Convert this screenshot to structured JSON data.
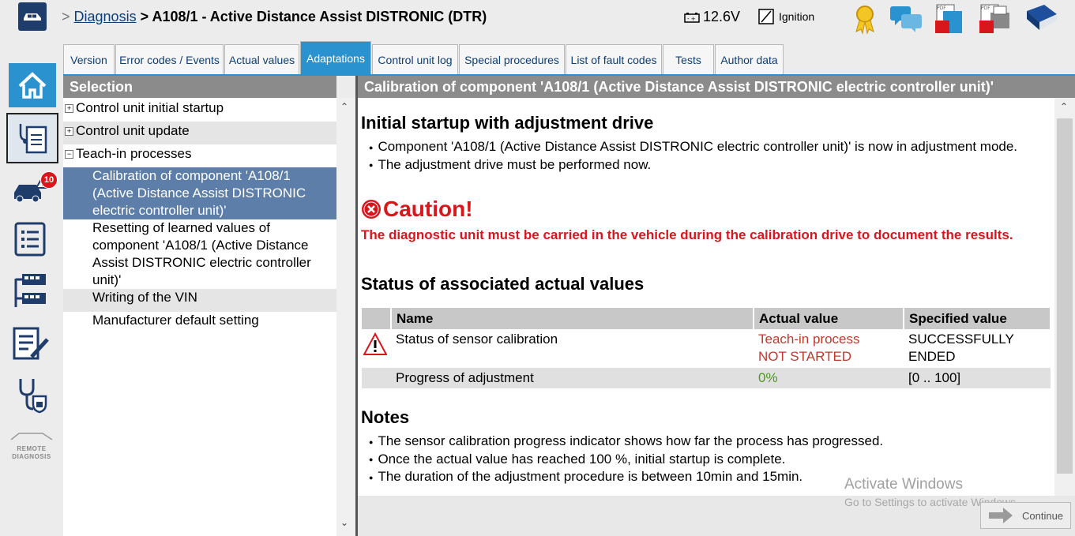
{
  "header": {
    "breadcrumb_sep": ">",
    "breadcrumb_link": "Diagnosis",
    "breadcrumb_current": "> A108/1 - Active Distance Assist DISTRONIC (DTR)",
    "voltage": "12.6V",
    "ignition_label": "Ignition"
  },
  "rail": {
    "badge_count": "10",
    "remote_line1": "REMOTE",
    "remote_line2": "DIAGNOSIS"
  },
  "tabs": [
    {
      "label": "Version"
    },
    {
      "label": "Error codes / Events"
    },
    {
      "label": "Actual values"
    },
    {
      "label": "Adaptations"
    },
    {
      "label": "Control unit log"
    },
    {
      "label": "Special procedures"
    },
    {
      "label": "List of fault codes"
    },
    {
      "label": "Tests"
    },
    {
      "label": "Author data"
    }
  ],
  "left_panel": {
    "header": "Selection",
    "items": [
      {
        "label": "Control unit initial startup",
        "toggle": "+"
      },
      {
        "label": "Control unit update",
        "toggle": "+"
      },
      {
        "label": "Teach-in processes",
        "toggle": "−"
      },
      {
        "label": "Calibration of component 'A108/1 (Active Distance Assist DISTRONIC electric controller unit)'"
      },
      {
        "label": "Resetting of learned values of component 'A108/1 (Active Distance Assist DISTRONIC electric controller unit)'"
      },
      {
        "label": "Writing of the VIN"
      },
      {
        "label": "Manufacturer default setting"
      }
    ]
  },
  "right_panel": {
    "header": "Calibration of component 'A108/1 (Active Distance Assist DISTRONIC electric controller unit)'",
    "section1_title": "Initial startup with adjustment drive",
    "section1_bullets": [
      "Component 'A108/1 (Active Distance Assist DISTRONIC electric controller unit)' is now in adjustment mode.",
      "The adjustment drive must be performed now."
    ],
    "caution_title": "Caution!",
    "caution_text": "The diagnostic unit must be carried in the vehicle during the calibration drive to document the results.",
    "section2_title": "Status of associated actual values",
    "table": {
      "headers": [
        "Name",
        "Actual value",
        "Specified value"
      ],
      "rows": [
        {
          "name": "Status of sensor calibration",
          "actual_line1": "Teach-in process",
          "actual_line2": "NOT STARTED",
          "specified_line1": "SUCCESSFULLY",
          "specified_line2": "ENDED"
        },
        {
          "name": "Progress of adjustment",
          "actual": "0%",
          "specified": "[0 .. 100]"
        }
      ]
    },
    "section3_title": "Notes",
    "notes": [
      "The sensor calibration progress indicator shows how far the process has progressed.",
      "Once the actual value has reached 100 %, initial startup is complete.",
      "The duration of the adjustment procedure is between 10min and 15min."
    ]
  },
  "watermark": {
    "line1": "Activate Windows",
    "line2": "Go to Settings to activate Windows."
  },
  "footer": {
    "continue_label": "Continue"
  },
  "colors": {
    "accent_blue": "#2a92cf",
    "selection_blue": "#5d7ea8",
    "caution_red": "#d8161b",
    "header_grey": "#8b8b8b"
  }
}
